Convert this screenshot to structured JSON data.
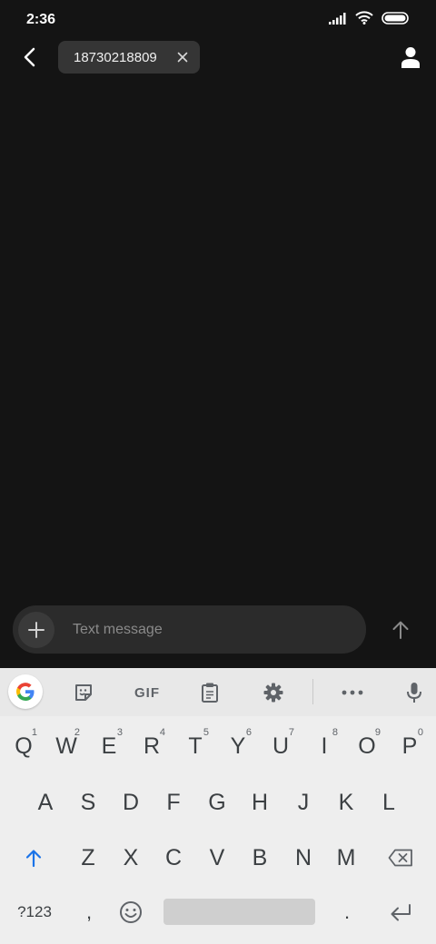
{
  "status": {
    "time": "2:36"
  },
  "header": {
    "recipient": "18730218809"
  },
  "compose": {
    "placeholder": "Text message"
  },
  "keyboard": {
    "toolbar": {
      "gif_label": "GIF"
    },
    "row1": [
      {
        "label": "Q",
        "hint": "1"
      },
      {
        "label": "W",
        "hint": "2"
      },
      {
        "label": "E",
        "hint": "3"
      },
      {
        "label": "R",
        "hint": "4"
      },
      {
        "label": "T",
        "hint": "5"
      },
      {
        "label": "Y",
        "hint": "6"
      },
      {
        "label": "U",
        "hint": "7"
      },
      {
        "label": "I",
        "hint": "8"
      },
      {
        "label": "O",
        "hint": "9"
      },
      {
        "label": "P",
        "hint": "0"
      }
    ],
    "row2": [
      "A",
      "S",
      "D",
      "F",
      "G",
      "H",
      "J",
      "K",
      "L"
    ],
    "row3": [
      "Z",
      "X",
      "C",
      "V",
      "B",
      "N",
      "M"
    ],
    "bottom": {
      "symbols": "?123",
      "comma": ",",
      "period": "."
    }
  }
}
